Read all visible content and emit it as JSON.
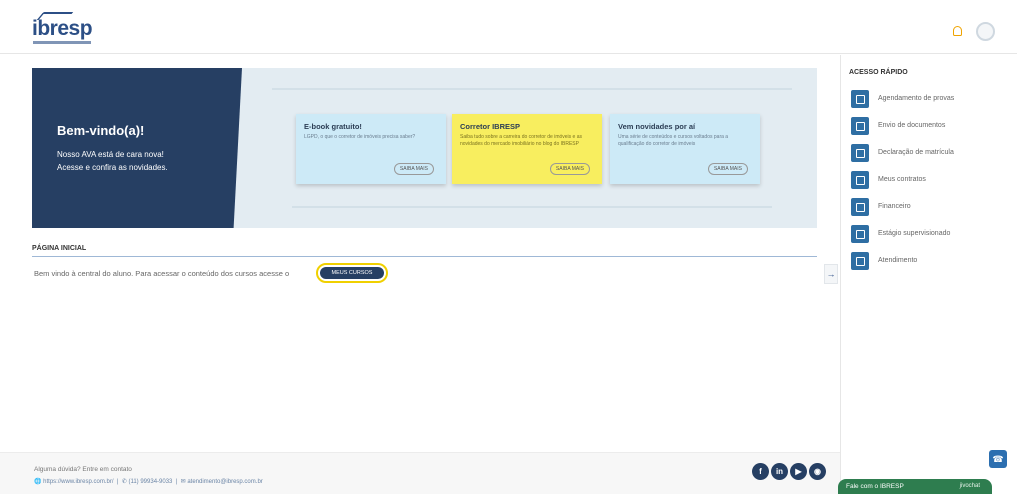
{
  "brand": {
    "logo_text": "ibresp"
  },
  "header": {
    "bell_icon": "bell-icon",
    "avatar_icon": "user-avatar-icon"
  },
  "banner": {
    "title": "Bem-vindo(a)!",
    "line1": "Nosso AVA está de cara nova!",
    "line2": "Acesse e confira as novidades.",
    "cards": [
      {
        "title": "E-book gratuito!",
        "text": "LGPD, o que o corretor de imóveis precisa saber?",
        "button": "SAIBA MAIS",
        "color": "#cdeaf7"
      },
      {
        "title": "Corretor IBRESP",
        "text": "Saiba tudo sobre a carreira do corretor de imóveis e as novidades do mercado imobiliário no blog do IBRESP",
        "button": "SAIBA MAIS",
        "color": "#f8ee5f"
      },
      {
        "title": "Vem novidades por aí",
        "text": "Uma série de conteúdos e cursos voltados para a qualificação do corretor de imóveis",
        "button": "SAIBA MAIS",
        "color": "#cdeaf7"
      }
    ]
  },
  "page": {
    "section_title": "PÁGINA INICIAL",
    "welcome": "Bem vindo à central do aluno. Para acessar o conteúdo dos cursos acesse o",
    "cursos_button": "MEUS CURSOS",
    "collapse_icon": "arrow-right-icon"
  },
  "sidebar": {
    "title": "ACESSO RÁPIDO",
    "items": [
      {
        "label": "Agendamento de provas",
        "icon": "calendar-icon"
      },
      {
        "label": "Envio de documentos",
        "icon": "folder-icon"
      },
      {
        "label": "Declaração de matrícula",
        "icon": "document-icon"
      },
      {
        "label": "Meus contratos",
        "icon": "contract-icon"
      },
      {
        "label": "Financeiro",
        "icon": "folder-icon"
      },
      {
        "label": "Estágio supervisionado",
        "icon": "person-icon"
      },
      {
        "label": "Atendimento",
        "icon": "chat-icon"
      }
    ]
  },
  "footer": {
    "question": "Alguma dúvida? Entre em contato",
    "site": "https://www.ibresp.com.br/",
    "phone": "(11) 99934-9033",
    "email": "atendimento@ibresp.com.br",
    "social": [
      "facebook-icon",
      "linkedin-icon",
      "youtube-icon",
      "instagram-icon"
    ]
  },
  "chat": {
    "label": "Fale com o IBRESP",
    "brand": "jivochat"
  },
  "colors": {
    "primary": "#263f63",
    "accent": "#2e6ea3",
    "highlight": "#f0d000",
    "chat": "#2e7d4f"
  }
}
